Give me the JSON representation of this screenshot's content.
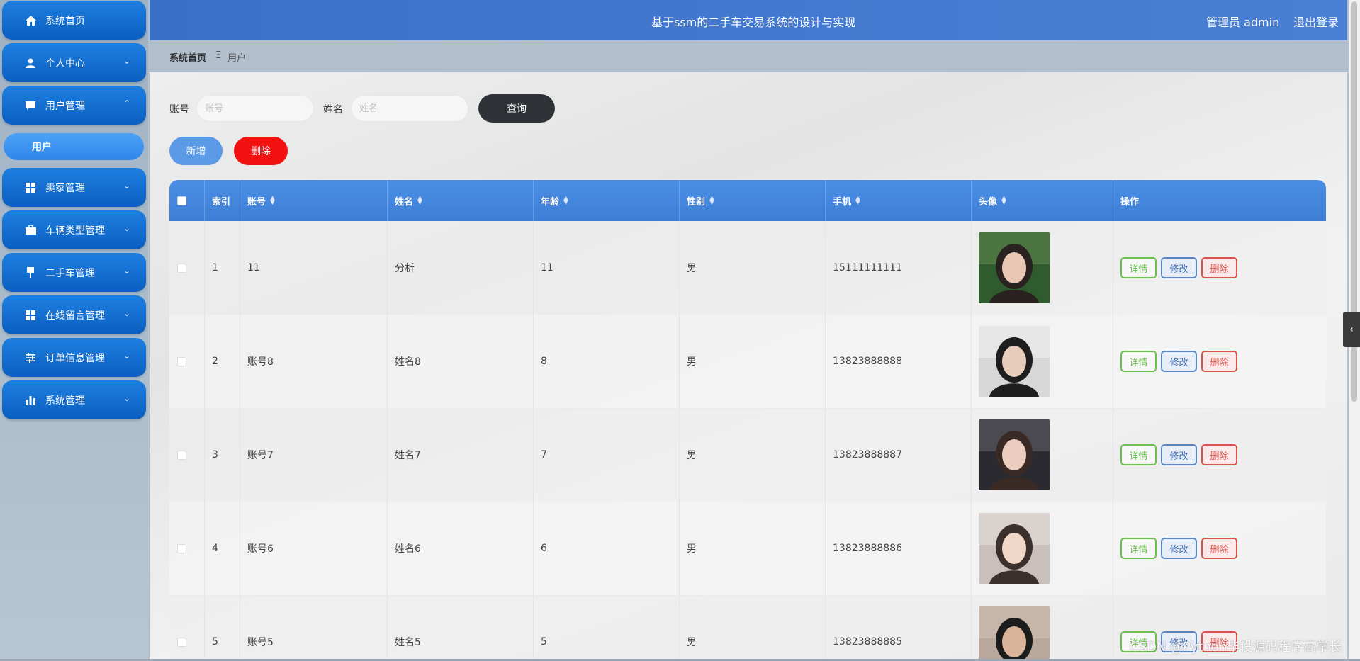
{
  "sidebar": {
    "items": [
      {
        "label": "系统首页",
        "icon": "home-icon"
      },
      {
        "label": "个人中心",
        "icon": "person-icon",
        "expandable": true
      },
      {
        "label": "用户管理",
        "icon": "chat-icon",
        "expandable": true,
        "expanded": true
      },
      {
        "label": "卖家管理",
        "icon": "grid-icon",
        "expandable": true
      },
      {
        "label": "车辆类型管理",
        "icon": "briefcase-icon",
        "expandable": true
      },
      {
        "label": "二手车管理",
        "icon": "pin-icon",
        "expandable": true
      },
      {
        "label": "在线留言管理",
        "icon": "grid-icon",
        "expandable": true
      },
      {
        "label": "订单信息管理",
        "icon": "sliders-icon",
        "expandable": true
      },
      {
        "label": "系统管理",
        "icon": "bar-chart-icon",
        "expandable": true
      }
    ],
    "submenu": {
      "label": "用户"
    },
    "chevron_down": "⌄",
    "chevron_up": "⌃"
  },
  "header": {
    "title": "基于ssm的二手车交易系统的设计与实现",
    "admin": "管理员 admin",
    "logout": "退出登录"
  },
  "breadcrumb": {
    "home": "系统首页",
    "sep": "Ξ",
    "current": "用户"
  },
  "search": {
    "account_label": "账号",
    "account_placeholder": "账号",
    "name_label": "姓名",
    "name_placeholder": "姓名",
    "query_button": "查询"
  },
  "actions": {
    "add": "新增",
    "delete": "删除"
  },
  "table": {
    "headers": {
      "index": "索引",
      "account": "账号",
      "name": "姓名",
      "age": "年龄",
      "gender": "性别",
      "phone": "手机",
      "avatar": "头像",
      "ops": "操作"
    },
    "rows": [
      {
        "index": "1",
        "account": "11",
        "name": "分析",
        "age": "11",
        "gender": "男",
        "phone": "15111111111"
      },
      {
        "index": "2",
        "account": "账号8",
        "name": "姓名8",
        "age": "8",
        "gender": "男",
        "phone": "13823888888"
      },
      {
        "index": "3",
        "account": "账号7",
        "name": "姓名7",
        "age": "7",
        "gender": "男",
        "phone": "13823888887"
      },
      {
        "index": "4",
        "account": "账号6",
        "name": "姓名6",
        "age": "6",
        "gender": "男",
        "phone": "13823888886"
      },
      {
        "index": "5",
        "account": "账号5",
        "name": "姓名5",
        "age": "5",
        "gender": "男",
        "phone": "13823888885"
      }
    ],
    "op_labels": {
      "detail": "详情",
      "edit": "修改",
      "delete": "删除"
    }
  },
  "watermark": "CSDN @Python毕设源码程序高学长",
  "collapse_icon": "‹",
  "colors": {
    "header_blue": "#3f7ed6",
    "menu_blue": "#0b5fc0",
    "delete_red": "#f21212",
    "query_dark": "#2f3237"
  }
}
